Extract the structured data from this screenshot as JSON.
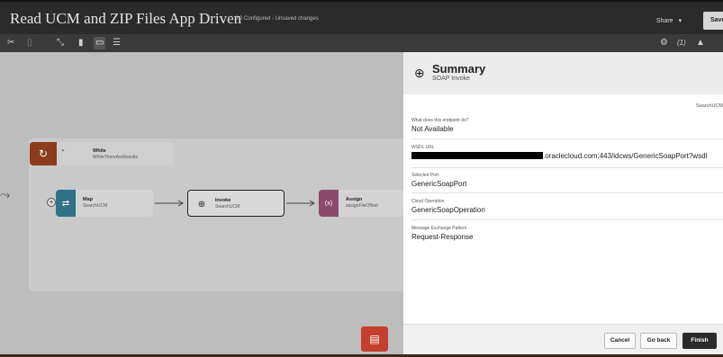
{
  "app": {
    "title": "Read UCM and ZIP Files App Driven",
    "version_status": "1.0.0 Configured - Unsaved changes",
    "share_label": "Share",
    "save_label": "Save"
  },
  "toolbar": {
    "icons": [
      "scissors-icon",
      "paste-icon",
      "collapse-icon",
      "vertical-layout-icon",
      "horizontal-layout-icon",
      "canvas-view-icon"
    ],
    "right_badge": "(1)"
  },
  "canvas": {
    "while": {
      "title": "While",
      "subtitle": "WhileThereAreResults"
    },
    "nodes": [
      {
        "title": "Map",
        "subtitle": "SearchUCM"
      },
      {
        "title": "Invoke",
        "subtitle": "SearchUCM"
      },
      {
        "title": "Assign",
        "subtitle": "assignFileOffset"
      }
    ]
  },
  "summary": {
    "title": "Summary",
    "subtitle": "SOAP Invoke",
    "reference_name": "SearchUCM",
    "fields": [
      {
        "label": "What does this endpoint do?",
        "value": "Not Available"
      },
      {
        "label": "WSDL URL",
        "value": ".oraclecloud.com:443/idcws/GenericSoapPort?wsdl"
      },
      {
        "label": "Selected Port",
        "value": "GenericSoapPort"
      },
      {
        "label": "Cloud Operation",
        "value": "GenericSoapOperation"
      },
      {
        "label": "Message Exchange Pattern",
        "value": "Request-Response"
      }
    ],
    "buttons": {
      "cancel": "Cancel",
      "go_back": "Go back",
      "finish": "Finish"
    }
  },
  "colors": {
    "header_bg": "#2b2b2b",
    "canvas_bg": "#bdbdbd",
    "while_accent": "#8a3c1c",
    "map_accent": "#2f7287",
    "assign_accent": "#8b4a6d",
    "fab_accent": "#c43f2d"
  }
}
